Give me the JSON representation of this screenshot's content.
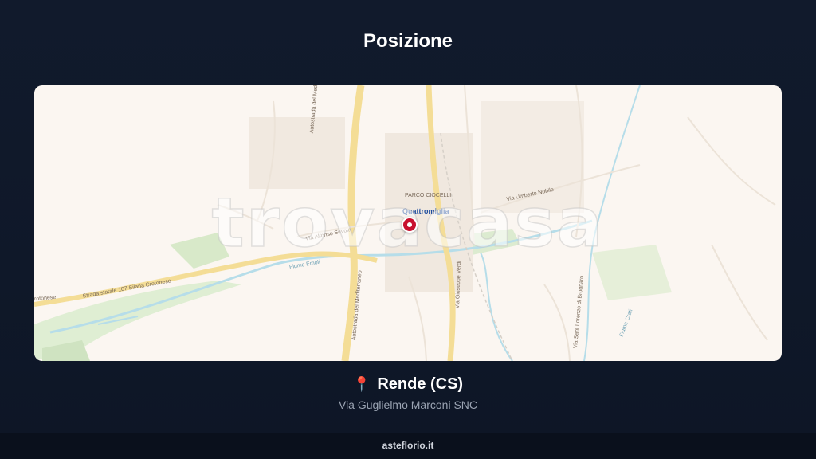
{
  "page": {
    "title": "Posizione"
  },
  "map": {
    "watermark": "trovacasa",
    "labels": {
      "quattromiglia": "Quattromiglia",
      "parco": "PARCO CIOCELLI",
      "strada_silana": "Strada statale 107 Silana Crotonese",
      "crotonese": "rotonese",
      "autostrada_1": "Autostrada del Mediterraneo",
      "autostrada_2": "Autostrada del Mediterraneo",
      "via_umberto_nobile": "Via Umberto Nobile",
      "via_giuseppe_verdi": "Via Giuseppe Verdi",
      "via_san_lorenzo": "Via Sant Lorenzo di Brognaro",
      "fiume_emoli": "Fiume Emoli",
      "fiume_crati": "Fiume Crati",
      "via_alfonso": "Via Alfonso Savoia"
    }
  },
  "location": {
    "icon": "map-pin-icon",
    "name": "Rende (CS)",
    "address": "Via Guglielmo Marconi SNC"
  },
  "footer": {
    "brand": "asteflorio.it"
  },
  "colors": {
    "background": "#111a2c",
    "map_bg": "#fbf6f1",
    "pin": "#c8102e",
    "road_major": "#f5dc8c",
    "river": "#a9d8e8",
    "green": "#cfe3c1"
  }
}
